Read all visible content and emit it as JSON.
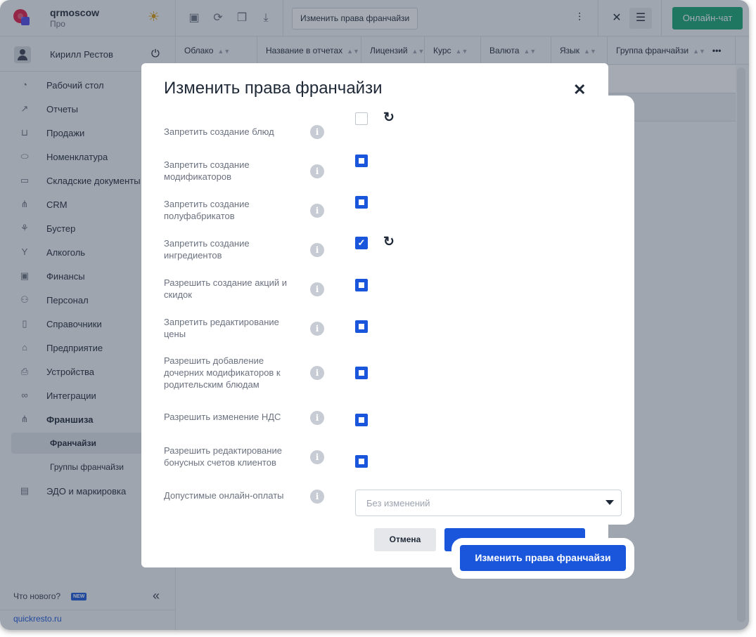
{
  "brand": {
    "name": "qrmoscow",
    "plan": "Про"
  },
  "user": {
    "name": "Кирилл Рестов"
  },
  "sidebar": {
    "items": [
      {
        "label": "Рабочий стол",
        "icon": "gauge-icon"
      },
      {
        "label": "Отчеты",
        "icon": "chart-icon"
      },
      {
        "label": "Продажи",
        "icon": "basket-icon"
      },
      {
        "label": "Номенклатура",
        "icon": "tag-icon"
      },
      {
        "label": "Складские документы",
        "icon": "archive-icon"
      },
      {
        "label": "CRM",
        "icon": "crm-icon"
      },
      {
        "label": "Бустер",
        "icon": "booster-icon"
      },
      {
        "label": "Алкоголь",
        "icon": "glass-icon"
      },
      {
        "label": "Финансы",
        "icon": "wallet-icon"
      },
      {
        "label": "Персонал",
        "icon": "people-icon"
      },
      {
        "label": "Справочники",
        "icon": "book-icon"
      },
      {
        "label": "Предприятие",
        "icon": "store-icon"
      },
      {
        "label": "Устройства",
        "icon": "printer-icon"
      },
      {
        "label": "Интеграции",
        "icon": "infinity-icon"
      },
      {
        "label": "Франшиза",
        "icon": "franchise-icon"
      }
    ],
    "subitems": [
      {
        "label": "Франчайзи",
        "active": true
      },
      {
        "label": "Группы франчайзи",
        "active": false
      }
    ],
    "last_item": {
      "label": "ЭДО и маркировка",
      "icon": "document-icon"
    },
    "whats_new": "Что нового?",
    "new_badge": "NEW",
    "site_link": "quickresto.ru"
  },
  "toolbar": {
    "change_rights_label": "Изменить права франчайзи",
    "online_chat_label": "Онлайн-чат"
  },
  "table": {
    "columns": [
      "Облако",
      "Название в отчетах",
      "Лицензий",
      "Курс",
      "Валюта",
      "Язык",
      "Группа франчайзи"
    ]
  },
  "modal": {
    "title": "Изменить права франчайзи",
    "settings": [
      {
        "label": "Запретить создание блюд",
        "state": "unchecked",
        "reset": true
      },
      {
        "label": "Запретить создание модификаторов",
        "state": "partial",
        "reset": false
      },
      {
        "label": "Запретить создание полуфабрикатов",
        "state": "partial",
        "reset": false
      },
      {
        "label": "Запретить создание ингредиентов",
        "state": "checked",
        "reset": true
      },
      {
        "label": "Разрешить создание акций и скидок",
        "state": "partial",
        "reset": false
      },
      {
        "label": "Запретить редактирование цены",
        "state": "partial",
        "reset": false
      },
      {
        "label": "Разрешить добавление дочерних модификаторов к родительским блюдам",
        "state": "partial",
        "reset": false
      },
      {
        "label": "Разрешить изменение НДС",
        "state": "partial",
        "reset": false
      },
      {
        "label": "Разрешить редактирование бонусных счетов клиентов",
        "state": "partial",
        "reset": false
      }
    ],
    "payments_label": "Допустимые онлайн-оплаты",
    "payments_value": "Без изменений",
    "cancel_label": "Отмена",
    "submit_label": "Изменить права франчайзи"
  },
  "colors": {
    "accent": "#1a56db",
    "chat": "#17a673"
  }
}
